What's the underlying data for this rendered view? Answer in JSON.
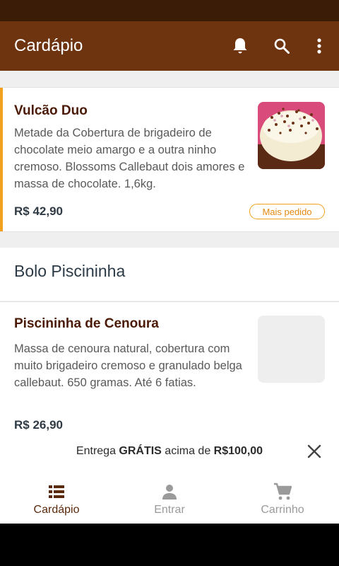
{
  "header": {
    "title": "Cardápio",
    "actions": [
      "bell-icon",
      "search-icon",
      "more-vert-icon"
    ]
  },
  "items": [
    {
      "name": "Vulcão Duo",
      "description": "Metade da Cobertura de brigadeiro de chocolate meio amargo e a outra ninho cremoso. Blossoms Callebaut dois amores e massa de chocolate. 1,6kg.",
      "price": "R$ 42,90",
      "badge": "Mais pedido"
    }
  ],
  "section": {
    "title": "Bolo Piscininha",
    "items": [
      {
        "name": "Piscininha de Cenoura",
        "description": "Massa de cenoura natural, cobertura com muito brigadeiro cremoso e granulado belga callebaut. 650 gramas. Até 6 fatias.",
        "price": "R$ 26,90"
      }
    ]
  },
  "delivery": {
    "prefix": "Entrega ",
    "free": "GRÁTIS",
    "middle": " acima de ",
    "amount": "R$100,00"
  },
  "nav": [
    {
      "label": "Cardápio",
      "icon": "menu-list-icon",
      "active": true
    },
    {
      "label": "Entrar",
      "icon": "person-icon",
      "active": false
    },
    {
      "label": "Carrinho",
      "icon": "cart-icon",
      "active": false
    }
  ],
  "colors": {
    "status_bar": "#3a1c07",
    "app_bar": "#6e3410",
    "accent": "#f2a11f",
    "item_name": "#4a1a06"
  }
}
